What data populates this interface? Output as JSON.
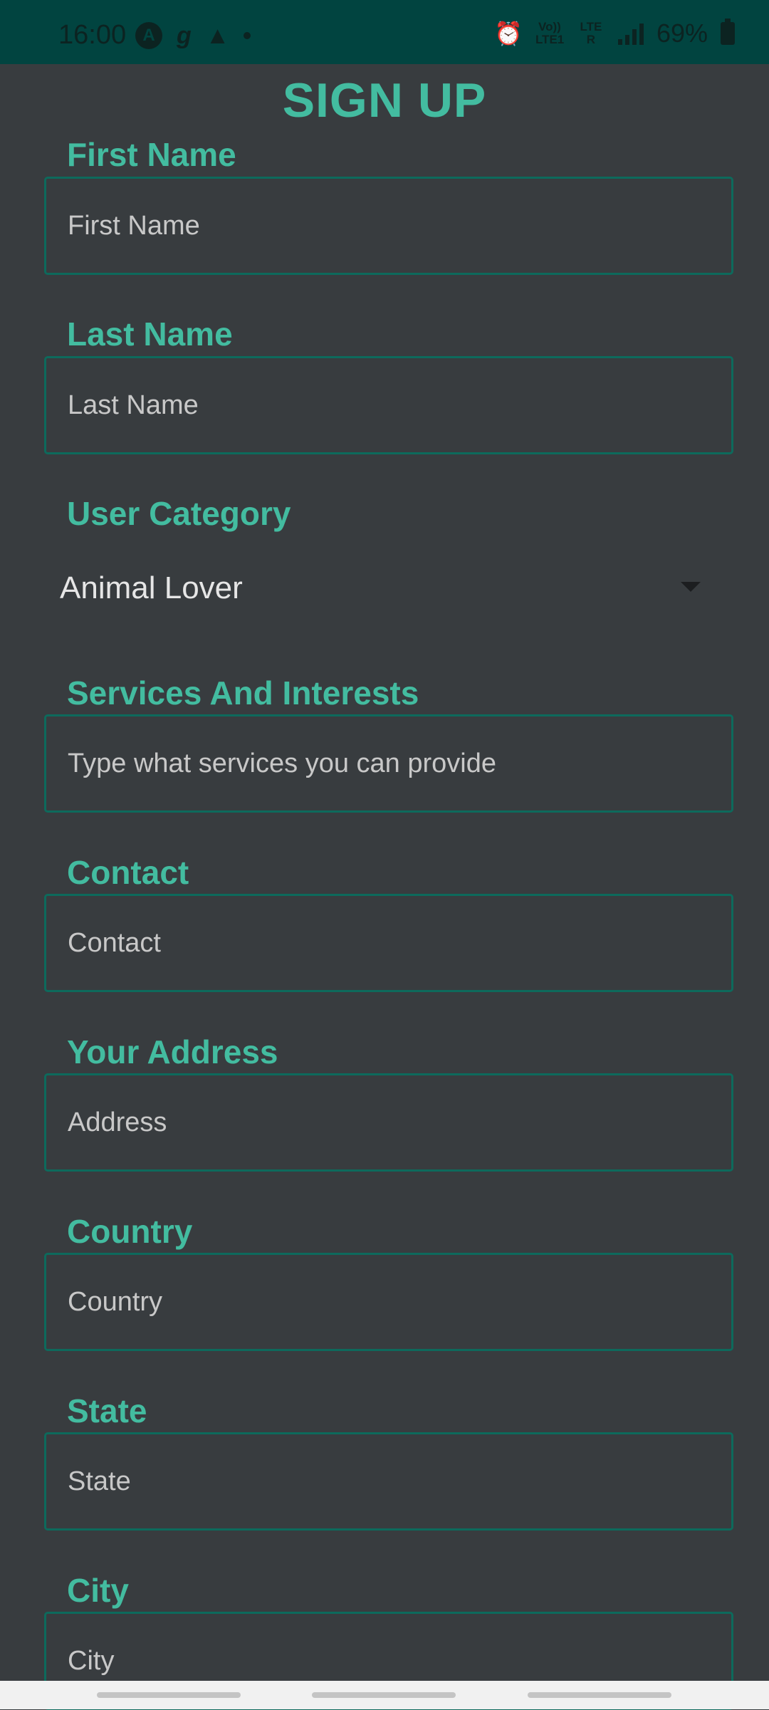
{
  "status_bar": {
    "time": "16:00",
    "left_icons": [
      "app-a-icon",
      "g-icon",
      "warning-icon",
      "dot-icon"
    ],
    "volte": "Vo)) LTE1",
    "lte": "LTE R",
    "battery_percent": "69%"
  },
  "form": {
    "title": "SIGN UP",
    "first_name": {
      "label": "First Name",
      "placeholder": "First Name"
    },
    "last_name": {
      "label": "Last Name",
      "placeholder": "Last Name"
    },
    "user_category": {
      "label": "User Category",
      "selected": "Animal Lover"
    },
    "services": {
      "label": "Services And Interests",
      "placeholder": "Type what services you can provide"
    },
    "contact": {
      "label": "Contact",
      "placeholder": "Contact"
    },
    "address": {
      "label": "Your Address",
      "placeholder": "Address"
    },
    "country": {
      "label": "Country",
      "placeholder": "Country"
    },
    "state": {
      "label": "State",
      "placeholder": "State"
    },
    "city": {
      "label": "City",
      "placeholder": "City"
    }
  },
  "colors": {
    "accent": "#43bca0",
    "background": "#383c3f",
    "status_bar": "#014440",
    "field_border": "#0d6a5c"
  }
}
